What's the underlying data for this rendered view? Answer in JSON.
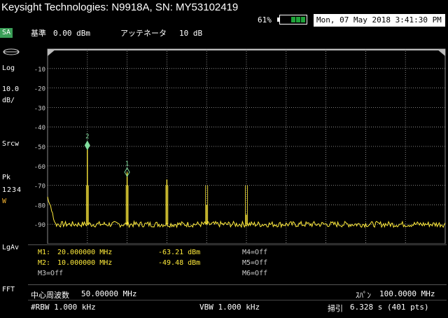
{
  "window": {
    "title": "Keysight Technologies: N9918A, SN: MY53102419",
    "battery_percent": "61%",
    "datetime": "Mon, 07 May 2018 3:41:30 PM"
  },
  "sidebar": {
    "mode": "SA",
    "scale_type": "Log",
    "scale_value": "10.0",
    "scale_unit": "dB/",
    "sweep": "Srcw",
    "detector": "Pk",
    "traces": "1234",
    "trace_mode": "W",
    "avg_mode": "LgAv",
    "sweep_type": "FFT"
  },
  "header": {
    "ref_level_label": "基準",
    "ref_level_value": "0.00 dBm",
    "attenuator_label": "アッテネータ",
    "attenuator_value": "10 dB"
  },
  "chart_data": {
    "type": "line",
    "ylabel": "dBm",
    "ylim": [
      -100,
      0
    ],
    "y_ticks": [
      "-10",
      "-20",
      "-30",
      "-40",
      "-50",
      "-60",
      "-70",
      "-80",
      "-90"
    ],
    "x_range_mhz": [
      0,
      100
    ],
    "grid": true,
    "noise_floor_dbm": -90,
    "peaks": [
      {
        "freq_mhz": 10,
        "dbm": -49.48,
        "marker": "2"
      },
      {
        "freq_mhz": 20,
        "dbm": -63.21,
        "marker": "1"
      },
      {
        "freq_mhz": 30,
        "dbm": -67
      },
      {
        "freq_mhz": 40,
        "dbm": -80
      },
      {
        "freq_mhz": 50,
        "dbm": -85
      }
    ],
    "trace_color": "#ffeb3b",
    "marker_color": "#7fdc9c"
  },
  "markers": {
    "m1_label": "M1:",
    "m1_freq": "20.000000 MHz",
    "m1_level": "-63.21 dBm",
    "m2_label": "M2:",
    "m2_freq": "10.000000 MHz",
    "m2_level": "-49.48 dBm",
    "m3": "M3=Off",
    "m4": "M4=Off",
    "m5": "M5=Off",
    "m6": "M6=Off"
  },
  "footer": {
    "center_label": "中心周波数",
    "center_value": "50.00000 MHz",
    "span_label": "ｽﾊﾟﾝ",
    "span_value": "100.0000 MHz",
    "rbw": "#RBW 1.000 kHz",
    "vbw": "VBW 1.000 kHz",
    "sweep_label": "掃引",
    "sweep_value": "6.328  s (401 pts)"
  }
}
